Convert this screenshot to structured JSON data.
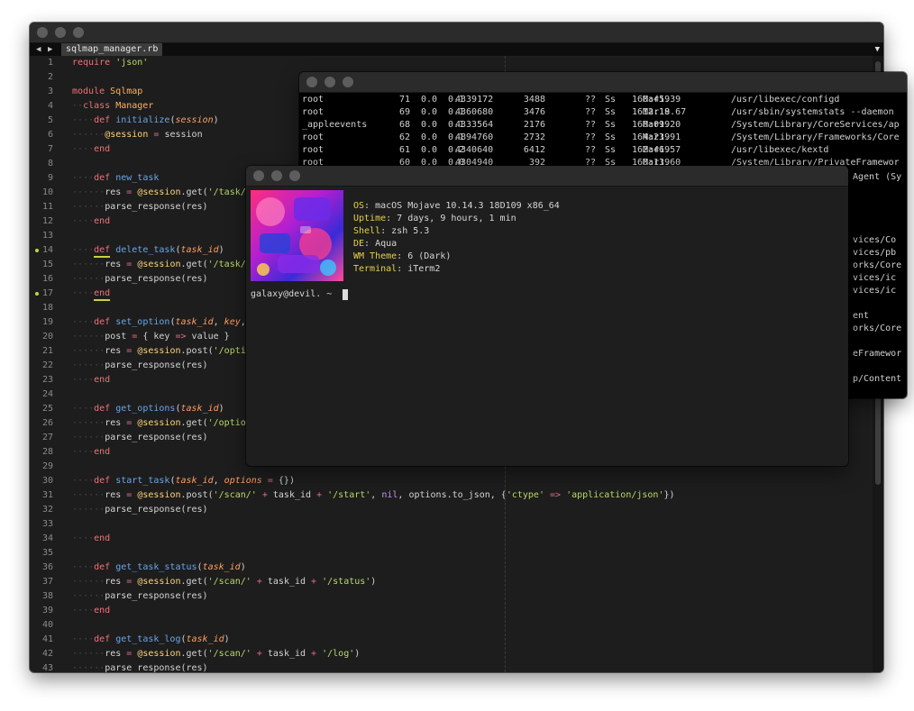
{
  "editor": {
    "tab_label": "sqlmap_manager.rb",
    "back_icon": "left-triangle-icon",
    "forward_icon": "right-triangle-icon",
    "dropdown_icon": "down-triangle-icon",
    "lines": [
      {
        "n": "1",
        "code": "require 'json'"
      },
      {
        "n": "2",
        "code": ""
      },
      {
        "n": "3",
        "code": "module Sqlmap"
      },
      {
        "n": "4",
        "code": "  class Manager"
      },
      {
        "n": "5",
        "code": "    def initialize(session)"
      },
      {
        "n": "6",
        "code": "      @session = session"
      },
      {
        "n": "7",
        "code": "    end"
      },
      {
        "n": "8",
        "code": ""
      },
      {
        "n": "9",
        "code": "    def new_task"
      },
      {
        "n": "10",
        "code": "      res = @session.get('/task/"
      },
      {
        "n": "11",
        "code": "      parse_response(res)"
      },
      {
        "n": "12",
        "code": "    end"
      },
      {
        "n": "13",
        "code": ""
      },
      {
        "n": "14",
        "code": "    def delete_task(task_id)",
        "marker": true
      },
      {
        "n": "15",
        "code": "      res = @session.get('/task/"
      },
      {
        "n": "16",
        "code": "      parse_response(res)"
      },
      {
        "n": "17",
        "code": "    end",
        "marker": true
      },
      {
        "n": "18",
        "code": ""
      },
      {
        "n": "19",
        "code": "    def set_option(task_id, key,"
      },
      {
        "n": "20",
        "code": "      post = { key => value }"
      },
      {
        "n": "21",
        "code": "      res = @session.post('/opti"
      },
      {
        "n": "22",
        "code": "      parse_response(res)"
      },
      {
        "n": "23",
        "code": "    end"
      },
      {
        "n": "24",
        "code": ""
      },
      {
        "n": "25",
        "code": "    def get_options(task_id)"
      },
      {
        "n": "26",
        "code": "      res = @session.get('/optio"
      },
      {
        "n": "27",
        "code": "      parse_response(res)"
      },
      {
        "n": "28",
        "code": "    end"
      },
      {
        "n": "29",
        "code": ""
      },
      {
        "n": "30",
        "code": "    def start_task(task_id, options = {})"
      },
      {
        "n": "31",
        "code": "      res = @session.post('/scan/' + task_id + '/start', nil, options.to_json, {'ctype' => 'application/json'})"
      },
      {
        "n": "32",
        "code": "      parse_response(res)"
      },
      {
        "n": "33",
        "code": ""
      },
      {
        "n": "34",
        "code": "    end"
      },
      {
        "n": "35",
        "code": ""
      },
      {
        "n": "36",
        "code": "    def get_task_status(task_id)"
      },
      {
        "n": "37",
        "code": "      res = @session.get('/scan/' + task_id + '/status')"
      },
      {
        "n": "38",
        "code": "      parse_response(res)"
      },
      {
        "n": "39",
        "code": "    end"
      },
      {
        "n": "40",
        "code": ""
      },
      {
        "n": "41",
        "code": "    def get_task_log(task_id)"
      },
      {
        "n": "42",
        "code": "      res = @session.get('/scan/' + task_id + '/log')"
      },
      {
        "n": "43",
        "code": "      parse_response(res)"
      }
    ]
  },
  "ps": {
    "rows": [
      [
        "root",
        "71",
        "0.0",
        "0.1",
        "4339172",
        "3488",
        "??",
        "Ss",
        "16Mar19",
        "0:45.39",
        "/usr/libexec/configd"
      ],
      [
        "root",
        "69",
        "0.0",
        "0.1",
        "4360680",
        "3476",
        "??",
        "Ss",
        "16Mar19",
        "12:18.67",
        "/usr/sbin/systemstats --daemon"
      ],
      [
        "_appleevents",
        "68",
        "0.0",
        "0.1",
        "4333564",
        "2176",
        "??",
        "Ss",
        "16Mar19",
        "0:09.20",
        "/System/Library/CoreServices/ap"
      ],
      [
        "root",
        "62",
        "0.0",
        "0.1",
        "4894760",
        "2732",
        "??",
        "Ss",
        "16Mar19",
        "4:23.91",
        "/System/Library/Frameworks/Core"
      ],
      [
        "root",
        "61",
        "0.0",
        "0.2",
        "4340640",
        "6412",
        "??",
        "Ss",
        "16Mar19",
        "2:46.57",
        "/usr/libexec/kextd"
      ],
      [
        "root",
        "60",
        "0.0",
        "0.0",
        "4304940",
        "392",
        "??",
        "Ss",
        "16Mar19",
        "0:13.60",
        "/System/Library/PrivateFramewor"
      ]
    ],
    "visible_fragments": [
      "Agent (Sy",
      "vices/Co",
      "vices/pb",
      "orks/Core",
      "vices/ic",
      "vices/ic",
      "ent",
      "orks/Core",
      "eFramewor",
      "p/Content"
    ]
  },
  "neofetch": {
    "art_icon": "neofetch-ascii-art-image",
    "info": [
      {
        "k": "OS",
        "v": "macOS Mojave 10.14.3 18D109 x86_64"
      },
      {
        "k": "Uptime",
        "v": "7 days, 9 hours, 1 min"
      },
      {
        "k": "Shell",
        "v": "zsh 5.3"
      },
      {
        "k": "DE",
        "v": "Aqua"
      },
      {
        "k": "WM Theme",
        "v": "6 (Dark)"
      },
      {
        "k": "Terminal",
        "v": "iTerm2"
      }
    ],
    "prompt": "galaxy@devil. ~"
  },
  "colors": {
    "editor_bg": "#1d1d1d",
    "terminal_bg": "#000000",
    "neofetch_bg": "#1e1e1e",
    "keyword": "#f07178",
    "function": "#6aa6e8",
    "string": "#b8d86b",
    "info_key": "#e5d04a"
  }
}
